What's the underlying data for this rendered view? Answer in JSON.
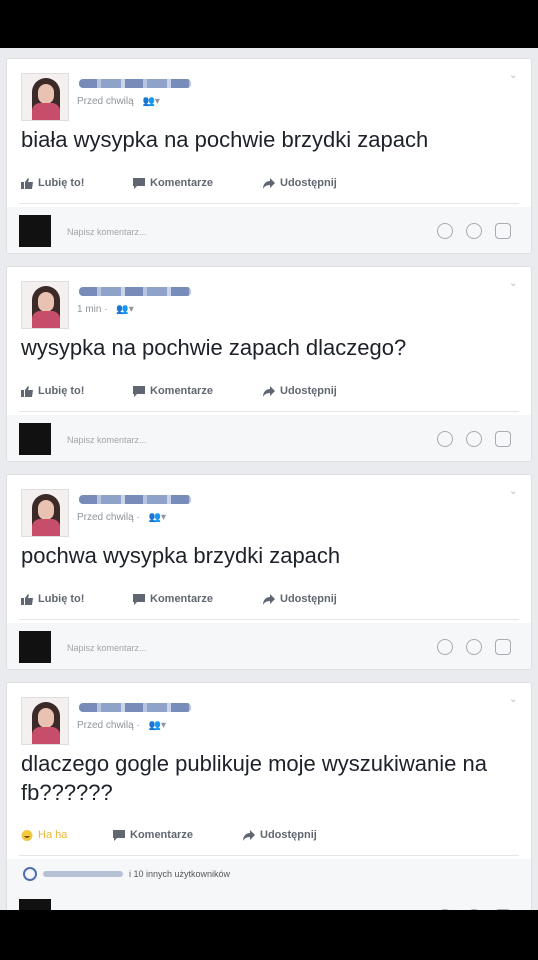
{
  "posts": [
    {
      "time": "Przed chwilą",
      "text": "biała wysypka na pochwie brzydki zapach",
      "actions": {
        "like": "Lubię to!",
        "comment": "Komentarze",
        "share": "Udostępnij"
      },
      "comment_placeholder": "Napisz komentarz..."
    },
    {
      "time": "1 min ·",
      "text": "wysypka na pochwie zapach dlaczego?",
      "actions": {
        "like": "Lubię to!",
        "comment": "Komentarze",
        "share": "Udostępnij"
      },
      "comment_placeholder": "Napisz komentarz..."
    },
    {
      "time": "Przed chwilą ·",
      "text": "pochwa wysypka brzydki zapach",
      "actions": {
        "like": "Lubię to!",
        "comment": "Komentarze",
        "share": "Udostępnij"
      },
      "comment_placeholder": "Napisz komentarz..."
    },
    {
      "time": "Przed chwilą ·",
      "text": "dlaczego gogle publikuje moje wyszukiwanie na fb??????",
      "actions": {
        "like": "Ha ha",
        "comment": "Komentarze",
        "share": "Udostępnij"
      },
      "likes_text": "i 10 innych użytkowników"
    }
  ],
  "colors": {
    "link": "#4267b2",
    "background": "#e9ebee",
    "text": "#1d2129",
    "muted": "#90949c"
  },
  "icons": {
    "like": "thumbs-up-icon",
    "haha": "haha-emoji-icon",
    "comment": "comment-icon",
    "share": "share-arrow-icon"
  }
}
